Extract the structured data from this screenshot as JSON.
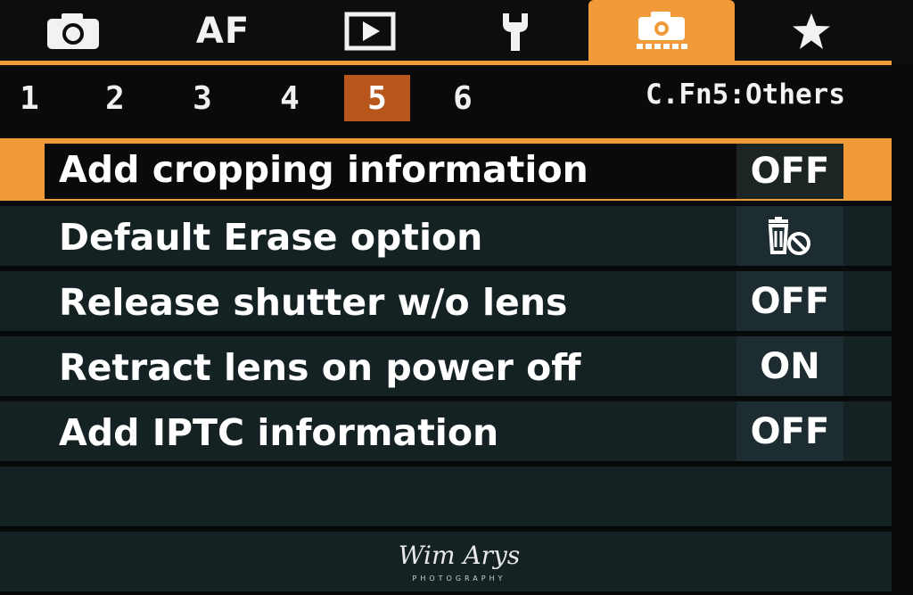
{
  "tabs": [
    {
      "icon": "camera-icon",
      "active": false
    },
    {
      "label": "AF",
      "active": false
    },
    {
      "icon": "playback-icon",
      "active": false
    },
    {
      "icon": "wrench-icon",
      "active": false
    },
    {
      "icon": "custom-function-camera-icon",
      "active": true
    },
    {
      "icon": "star-icon",
      "active": false
    }
  ],
  "subtabs": [
    "1",
    "2",
    "3",
    "4",
    "5",
    "6"
  ],
  "active_subtab": "5",
  "section_label": "C.Fn5:Others",
  "menu": {
    "items": [
      {
        "label": "Add cropping information",
        "value": "OFF",
        "selected": true
      },
      {
        "label": "Default Erase option",
        "value_icon": "erase-cancel-icon",
        "selected": false
      },
      {
        "label": "Release shutter w/o lens",
        "value": "OFF",
        "selected": false
      },
      {
        "label": "Retract lens on power off",
        "value": "ON",
        "selected": false
      },
      {
        "label": "Add IPTC information",
        "value": "OFF",
        "selected": false
      }
    ]
  },
  "watermark": {
    "name": "Wim Arys",
    "sub": "PHOTOGRAPHY"
  },
  "colors": {
    "accent": "#f19a3a",
    "subtab_active": "#b8561c",
    "row_bg": "#152224"
  }
}
